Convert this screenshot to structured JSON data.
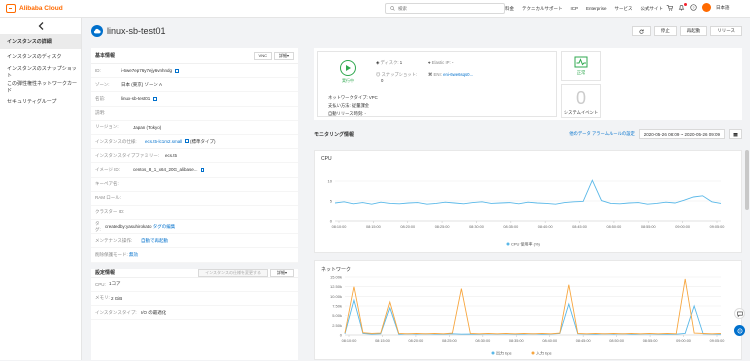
{
  "topbar": {
    "brand": "Alibaba Cloud",
    "search_placeholder": "検索",
    "nav": [
      "料金",
      "テクニカルサポート",
      "ICP",
      "Enterprise",
      "サービス",
      "公式サイト"
    ],
    "language": "日本語"
  },
  "sidebar": {
    "items": [
      {
        "label": "インスタンスの詳細",
        "active": true
      },
      {
        "label": "インスタンスのディスク",
        "active": false
      },
      {
        "label": "インスタンスのスナップショット",
        "active": false
      },
      {
        "label": "この弾性権性ネットワークカード",
        "active": false
      },
      {
        "label": "セキュリティグループ",
        "active": false
      }
    ]
  },
  "header": {
    "title": "linux-sb-test01",
    "actions": [
      "停止",
      "再起動",
      "リリース"
    ]
  },
  "basic_info": {
    "title": "基本情報",
    "vnc": "VNC",
    "more": "詳細▾",
    "rows": [
      {
        "k": "ID:",
        "v": "i-6we7ep76y7ejy6vnhndg",
        "copy": true
      },
      {
        "k": "ゾーン:",
        "v": "日本 (東京) ゾーン A"
      },
      {
        "k": "名前:",
        "v": "linux-sb-test01",
        "copy": true
      },
      {
        "k": "説明:",
        "v": ""
      },
      {
        "k": "リージョン:",
        "v": "Japan (Tokyo)"
      },
      {
        "k": "インスタンスの仕様:",
        "v": "ecs.t5-lc1m2.small",
        "suffix": "(標準タイプ)",
        "link": true,
        "copy": true
      },
      {
        "k": "インスタンスタイプファミリー:",
        "v": "ecs.t5"
      },
      {
        "k": "イメージ ID:",
        "v": "centos_8_1_x64_20G_alibase...",
        "copy": true
      },
      {
        "k": "キーペア名:",
        "v": ""
      },
      {
        "k": "RAM ロール:",
        "v": ""
      },
      {
        "k": "クラスター ID:",
        "v": ""
      },
      {
        "k": "タグ:",
        "v": "createdby:yasuhirokato",
        "extra": "タグの編集"
      },
      {
        "k": "メンテナンス操作:",
        "v": "",
        "extra": "自動で再起動"
      },
      {
        "k": "削除保護モード:",
        "v": "",
        "extra": "無効"
      }
    ]
  },
  "config_info": {
    "title": "設定情報",
    "change_btn": "インスタンスの仕様を変更する",
    "more": "詳細▾",
    "rows": [
      {
        "k": "CPU:",
        "v": "1コア"
      },
      {
        "k": "メモリ:",
        "v": "2 GiB"
      },
      {
        "k": "インスタンスタイプ:",
        "v": "I/O の最適化"
      }
    ]
  },
  "summary": {
    "state": "実行中",
    "disk_label": "ディスク:",
    "disk_count": "1",
    "snapshot_label": "スナップショット:",
    "snapshot_count": "0",
    "eip_label": "Elastic IP:",
    "eip_value": "-",
    "eni_label": "ENI:",
    "eni_value": "eni-6we6sqs0...",
    "network_type": "ネットワークタイプ: VPC",
    "billing": "支払い方法: 従量課金",
    "auto_release": "自動リリース時刻: -",
    "health_label": "正常",
    "events_count": "0",
    "events_label": "システムイベント"
  },
  "monitoring": {
    "title": "モニタリング情報",
    "links": "他のデータ アラームルールの設定",
    "date_range": "2020-05-26 08:09  ~  2020-05-26 09:09"
  },
  "chart_data": [
    {
      "type": "line",
      "title": "CPU",
      "x": [
        "08:10:00",
        "08:15:00",
        "08:20:00",
        "08:25:00",
        "08:30:00",
        "08:35:00",
        "08:40:00",
        "08:45:00",
        "08:50:00",
        "08:55:00",
        "09:00:00",
        "09:05:00"
      ],
      "yticks": [
        0,
        5,
        10
      ],
      "ylim": [
        0,
        12
      ],
      "series": [
        {
          "name": "CPU 使用率 (%)",
          "color": "#5ab8e8",
          "values": [
            4.5,
            4.8,
            4.3,
            4.6,
            4.2,
            4.7,
            4.4,
            4.3,
            4.5,
            4.6,
            4.2,
            4.4,
            4.7,
            4.5,
            4.3,
            4.6,
            4.8,
            4.4,
            4.5,
            4.6,
            4.3,
            4.7,
            4.5,
            4.4,
            4.2,
            4.6,
            4.8,
            4.9,
            10.2,
            5.1,
            4.4,
            4.3,
            4.5,
            4.6,
            4.2,
            4.4,
            4.7,
            4.5,
            5.2,
            6.0,
            6.3,
            4.8,
            4.4
          ]
        }
      ]
    },
    {
      "type": "line",
      "title": "ネットワーク",
      "x": [
        "08:10:00",
        "08:15:00",
        "08:20:00",
        "08:25:00",
        "08:30:00",
        "08:35:00",
        "08:40:00",
        "08:45:00",
        "08:50:00",
        "08:55:00",
        "09:00:00",
        "09:05:00"
      ],
      "yticks": [
        "0",
        "2.50k",
        "5.00k",
        "7.50k",
        "10.00k",
        "12.50k",
        "15.00k"
      ],
      "ylim": [
        0,
        15000
      ],
      "series": [
        {
          "name": "出力 bps",
          "color": "#5ab8e8",
          "values": [
            300,
            9000,
            400,
            200,
            300,
            7000,
            200,
            300,
            250,
            300,
            250,
            200,
            300,
            200,
            250,
            200,
            300,
            250,
            300,
            200,
            250,
            300,
            200,
            250,
            400,
            8000,
            300,
            250,
            200,
            300,
            250,
            300,
            200,
            250,
            300,
            200,
            250,
            200,
            400,
            7500,
            300,
            250,
            200
          ]
        },
        {
          "name": "入力 bps",
          "color": "#f7a63f",
          "values": [
            500,
            12500,
            600,
            400,
            500,
            8500,
            400,
            300,
            400,
            300,
            400,
            300,
            500,
            12000,
            400,
            300,
            400,
            300,
            400,
            300,
            400,
            300,
            400,
            300,
            500,
            13000,
            400,
            300,
            400,
            300,
            400,
            300,
            400,
            300,
            400,
            300,
            400,
            300,
            14500,
            500,
            400,
            300,
            400
          ]
        }
      ]
    }
  ]
}
